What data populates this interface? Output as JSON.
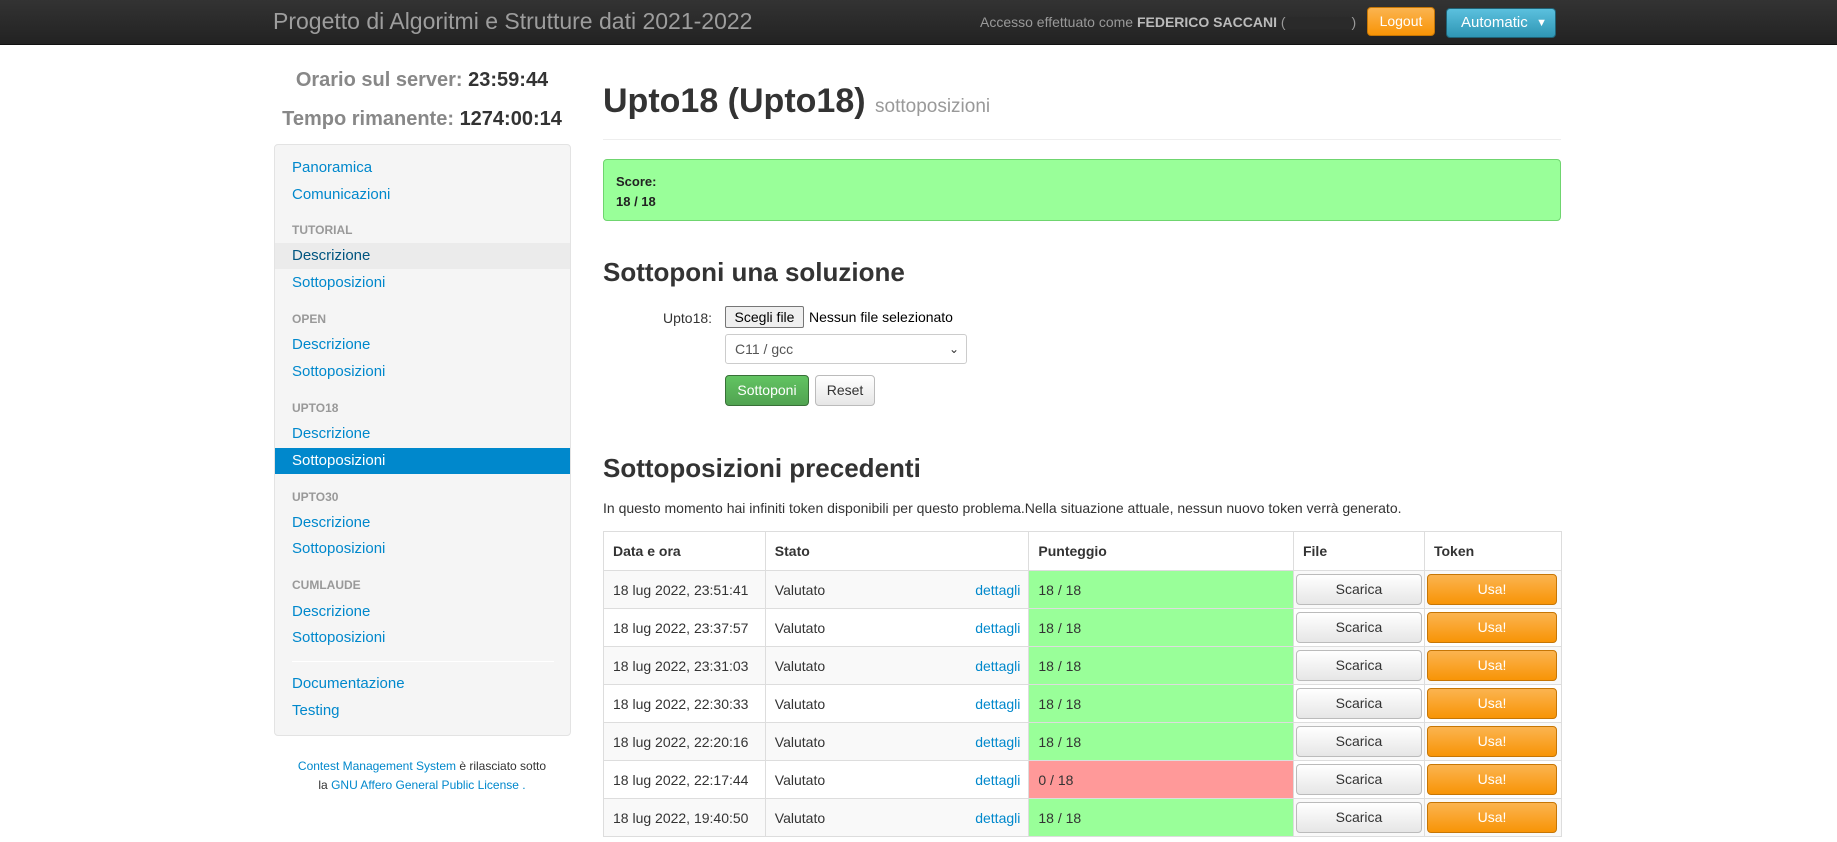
{
  "navbar": {
    "brand": "Progetto di Algoritmi e Strutture dati 2021-2022",
    "login_prefix": "Accesso effettuato come",
    "user_name": "FEDERICO SACCANI",
    "logout": "Logout",
    "language_select": "Automatic"
  },
  "clock": {
    "server_label": "Orario sul server:",
    "server_time": "23:59:44",
    "remaining_label": "Tempo rimanente:",
    "remaining_time": "1274:00:14"
  },
  "sidebar": {
    "overview": "Panoramica",
    "communications": "Comunicazioni",
    "sections": [
      {
        "header": "TUTORIAL",
        "description": "Descrizione",
        "submissions": "Sottoposizioni"
      },
      {
        "header": "OPEN",
        "description": "Descrizione",
        "submissions": "Sottoposizioni"
      },
      {
        "header": "UPTO18",
        "description": "Descrizione",
        "submissions": "Sottoposizioni"
      },
      {
        "header": "UPTO30",
        "description": "Descrizione",
        "submissions": "Sottoposizioni"
      },
      {
        "header": "CUMLAUDE",
        "description": "Descrizione",
        "submissions": "Sottoposizioni"
      }
    ],
    "documentation": "Documentazione",
    "testing": "Testing"
  },
  "license": {
    "cms": "Contest Management System",
    "released": "è rilasciato sotto",
    "la": "la",
    "gpl": "GNU Affero General Public License",
    "dot": "."
  },
  "main": {
    "title": "Upto18 (Upto18)",
    "subtitle": "sottoposizioni",
    "score_label": "Score:",
    "score_value": "18 / 18",
    "submit_heading": "Sottoponi una soluzione",
    "file_label": "Upto18:",
    "file_button": "Scegli file",
    "file_status": "Nessun file selezionato",
    "language": "C11 / gcc",
    "submit_button": "Sottoponi",
    "reset_button": "Reset",
    "previous_heading": "Sottoposizioni precedenti",
    "token_info": "In questo momento hai infiniti token disponibili per questo problema.Nella situazione attuale, nessun nuovo token verrà generato."
  },
  "table": {
    "headers": {
      "date": "Data e ora",
      "status": "Stato",
      "score": "Punteggio",
      "file": "File",
      "token": "Token"
    },
    "rows": [
      {
        "date": "18 lug 2022, 23:51:41",
        "status": "Valutato",
        "details": "dettagli",
        "score": "18 / 18",
        "ok": true,
        "download": "Scarica",
        "use": "Usa!"
      },
      {
        "date": "18 lug 2022, 23:37:57",
        "status": "Valutato",
        "details": "dettagli",
        "score": "18 / 18",
        "ok": true,
        "download": "Scarica",
        "use": "Usa!"
      },
      {
        "date": "18 lug 2022, 23:31:03",
        "status": "Valutato",
        "details": "dettagli",
        "score": "18 / 18",
        "ok": true,
        "download": "Scarica",
        "use": "Usa!"
      },
      {
        "date": "18 lug 2022, 22:30:33",
        "status": "Valutato",
        "details": "dettagli",
        "score": "18 / 18",
        "ok": true,
        "download": "Scarica",
        "use": "Usa!"
      },
      {
        "date": "18 lug 2022, 22:20:16",
        "status": "Valutato",
        "details": "dettagli",
        "score": "18 / 18",
        "ok": true,
        "download": "Scarica",
        "use": "Usa!"
      },
      {
        "date": "18 lug 2022, 22:17:44",
        "status": "Valutato",
        "details": "dettagli",
        "score": "0 / 18",
        "ok": false,
        "download": "Scarica",
        "use": "Usa!"
      },
      {
        "date": "18 lug 2022, 19:40:50",
        "status": "Valutato",
        "details": "dettagli",
        "score": "18 / 18",
        "ok": true,
        "download": "Scarica",
        "use": "Usa!"
      }
    ]
  },
  "colors": {
    "navbar": "#222222",
    "link": "#0088cc",
    "score_ok": "#99ff99",
    "score_bad": "#ff9999",
    "token_button": "#f89406",
    "submit_button": "#51a351"
  }
}
